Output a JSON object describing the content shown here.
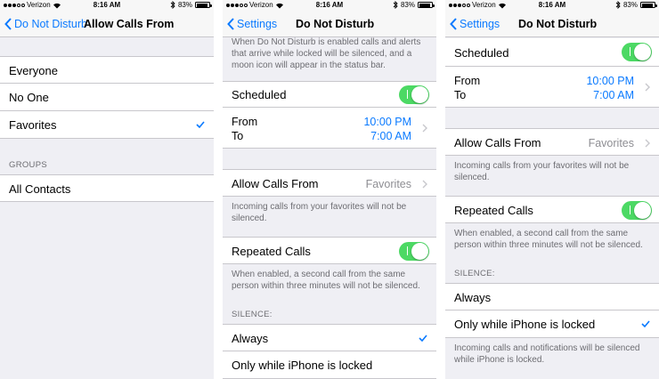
{
  "status": {
    "carrier": "Verizon",
    "time": "8:16 AM",
    "battery": "83%"
  },
  "colors": {
    "accent": "#0a7aff",
    "toggle_on": "#4cd964",
    "background": "#efeff4"
  },
  "icons": [
    "wifi-icon",
    "bluetooth-icon",
    "battery-icon",
    "chevron-left-icon",
    "chevron-right-icon",
    "checkmark-icon"
  ],
  "screen1": {
    "back": "Do Not Disturb",
    "title": "Allow Calls From",
    "options": [
      "Everyone",
      "No One",
      "Favorites"
    ],
    "groups_header": "GROUPS",
    "groups_item": "All Contacts"
  },
  "screen2": {
    "back": "Settings",
    "title": "Do Not Disturb",
    "intro": "When Do Not Disturb is enabled calls and alerts that arrive while locked will be silenced, and a moon icon will appear in the status bar.",
    "scheduled": "Scheduled",
    "from": "From",
    "to": "To",
    "from_time": "10:00 PM",
    "to_time": "7:00 AM",
    "allow_calls": "Allow Calls From",
    "allow_value": "Favorites",
    "allow_footer": "Incoming calls from your favorites will not be silenced.",
    "repeated": "Repeated Calls",
    "repeated_footer": "When enabled, a second call from the same person within three minutes will not be silenced.",
    "silence_header": "SILENCE:",
    "always": "Always",
    "only_locked": "Only while iPhone is locked"
  },
  "screen3": {
    "back": "Settings",
    "title": "Do Not Disturb",
    "scheduled": "Scheduled",
    "from": "From",
    "to": "To",
    "from_time": "10:00 PM",
    "to_time": "7:00 AM",
    "allow_calls": "Allow Calls From",
    "allow_value": "Favorites",
    "allow_footer": "Incoming calls from your favorites will not be silenced.",
    "repeated": "Repeated Calls",
    "repeated_footer": "When enabled, a second call from the same person within three minutes will not be silenced.",
    "silence_header": "SILENCE:",
    "always": "Always",
    "only_locked": "Only while iPhone is locked",
    "locked_footer": "Incoming calls and notifications will be silenced while iPhone is locked."
  }
}
